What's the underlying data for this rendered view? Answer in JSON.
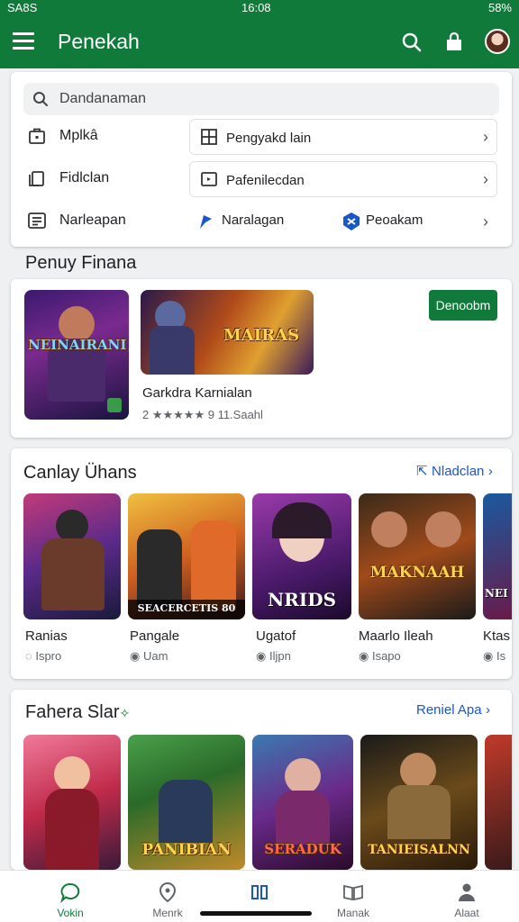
{
  "status": {
    "left": "SA8S",
    "time": "16:08",
    "right": "58%"
  },
  "app": {
    "title": "Penekah"
  },
  "search": {
    "placeholder": "Dandanaman"
  },
  "quick": [
    {
      "label": "Mplkâ",
      "pill_label": "Pengyakd lain"
    },
    {
      "label": "Fidlclan",
      "pill_label": "Pafenilecdan"
    },
    {
      "label": "Narleapan",
      "option1": "Naralagan",
      "option2": "Peoakam"
    }
  ],
  "featured": {
    "section_title": "Penuy Finana",
    "install_label": "Denoobm",
    "game_title": "Garkdra Karnialan",
    "rating_text": "2 ★★★★★ 9 11.Saahl",
    "art1": "NEINAIRANI",
    "art2": "MAIRAS"
  },
  "section2": {
    "title": "Canlay Ühans",
    "see_more": "Nladclan",
    "items": [
      {
        "name": "Ranias",
        "sub": "Ispro",
        "art": "SEACERCETIS 80"
      },
      {
        "name": "Pangale",
        "sub": "Uam",
        "art": ""
      },
      {
        "name": "Ugatof",
        "sub": "Iljpn",
        "art": "NRIDS"
      },
      {
        "name": "Maarlo Ileah",
        "sub": "Isapo",
        "art": "MAKNAAH"
      },
      {
        "name": "Ktas",
        "sub": "Is",
        "art": "NEI"
      }
    ]
  },
  "section3": {
    "title": "Fahera Slar",
    "see_more": "Reniel Apa",
    "items": [
      {
        "art": ""
      },
      {
        "art": "PANIBIAN"
      },
      {
        "art": "SERADUK"
      },
      {
        "art": "TANIEISALNN"
      },
      {
        "art": ""
      }
    ]
  },
  "nav": [
    {
      "label": "Vokin",
      "active": true
    },
    {
      "label": "Menrk"
    },
    {
      "label": ""
    },
    {
      "label": "Manak"
    },
    {
      "label": "Alaat"
    }
  ],
  "colors": {
    "brand": "#0f7a3a",
    "link": "#1a56c8"
  }
}
